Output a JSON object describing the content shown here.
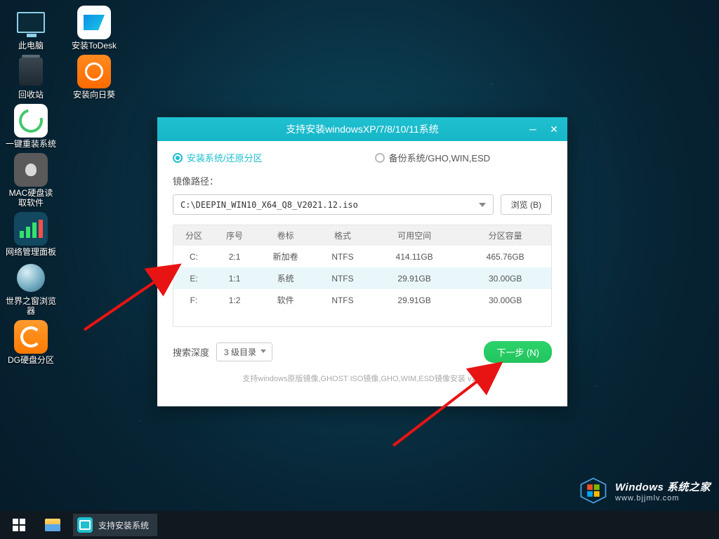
{
  "desktop": {
    "icons": [
      {
        "label": "此电脑"
      },
      {
        "label": "安装ToDesk"
      },
      {
        "label": "回收站"
      },
      {
        "label": "安装向日葵"
      },
      {
        "label": "一键重装系统"
      },
      {
        "label": "MAC硬盘读取软件"
      },
      {
        "label": "网络管理面板"
      },
      {
        "label": "世界之窗浏览器"
      },
      {
        "label": "DG硬盘分区"
      }
    ]
  },
  "window": {
    "title": "支持安装windowsXP/7/8/10/11系统",
    "radio_install": "安装系统/还原分区",
    "radio_backup": "备份系统/GHO,WIN,ESD",
    "path_label": "镜像路径：",
    "path_value": "C:\\DEEPIN_WIN10_X64_Q8_V2021.12.iso",
    "browse": "浏览 (B)",
    "table": {
      "headers": [
        "分区",
        "序号",
        "卷标",
        "格式",
        "可用空间",
        "分区容量"
      ],
      "rows": [
        {
          "part": "C:",
          "num": "2:1",
          "vol": "新加卷",
          "fmt": "NTFS",
          "free": "414.11GB",
          "cap": "465.76GB",
          "sel": false
        },
        {
          "part": "E:",
          "num": "1:1",
          "vol": "系统",
          "fmt": "NTFS",
          "free": "29.91GB",
          "cap": "30.00GB",
          "sel": true
        },
        {
          "part": "F:",
          "num": "1:2",
          "vol": "软件",
          "fmt": "NTFS",
          "free": "29.91GB",
          "cap": "30.00GB",
          "sel": false
        }
      ]
    },
    "depth_label": "搜索深度",
    "depth_value": "3 级目录",
    "next": "下一步 (N)",
    "support": "支持windows原版镜像,GHOST ISO镜像,GHO,WIM,ESD镜像安装 v1.0"
  },
  "taskbar": {
    "app": "支持安装系统"
  },
  "watermark": {
    "line1": "Windows 系统之家",
    "line2": "www.bjjmlv.com"
  }
}
